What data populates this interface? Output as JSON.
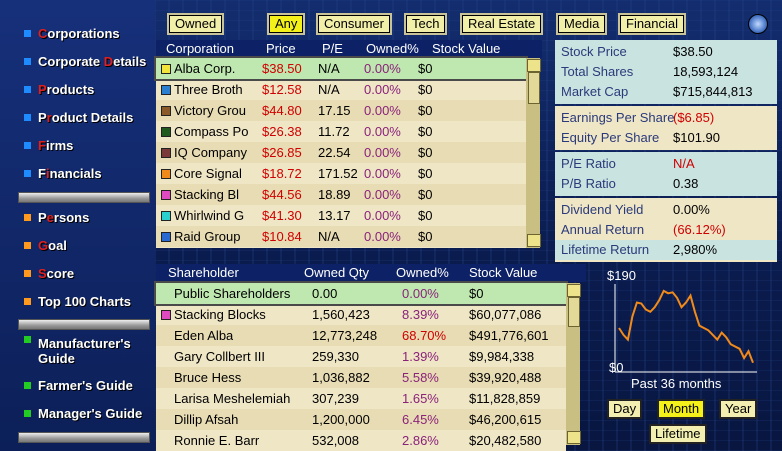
{
  "sidebar": {
    "items": [
      {
        "pre": "",
        "hl": "C",
        "post": "orporations",
        "color": "#1e8cff"
      },
      {
        "pre": "Corporate ",
        "hl": "D",
        "post": "etails",
        "color": "#1e8cff"
      },
      {
        "pre": "",
        "hl": "P",
        "post": "roducts",
        "color": "#1e8cff"
      },
      {
        "pre": "P",
        "hl": "r",
        "post": "oduct Details",
        "color": "#1e8cff"
      },
      {
        "pre": "",
        "hl": "F",
        "post": "irms",
        "color": "#1e8cff"
      },
      {
        "pre": "F",
        "hl": "i",
        "post": "nancials",
        "color": "#1e8cff"
      },
      {
        "pre": "P",
        "hl": "e",
        "post": "rsons",
        "color": "#ff9a1e"
      },
      {
        "pre": "",
        "hl": "G",
        "post": "oal",
        "color": "#ff9a1e"
      },
      {
        "pre": "",
        "hl": "S",
        "post": "core",
        "color": "#ff9a1e"
      },
      {
        "pre": "Top 100 Charts",
        "hl": "",
        "post": "",
        "color": "#ff9a1e"
      },
      {
        "pre": "Manufacturer's",
        "hl": "",
        "post": "",
        "line2": "Guide",
        "color": "#22cc22"
      },
      {
        "pre": "Farmer's Guide",
        "hl": "",
        "post": "",
        "color": "#22cc22"
      },
      {
        "pre": "Manager's Guide",
        "hl": "",
        "post": "",
        "color": "#22cc22"
      }
    ]
  },
  "filters": {
    "owned": "Owned",
    "any": "Any",
    "consumer": "Consumer",
    "tech": "Tech",
    "real_estate": "Real Estate",
    "media": "Media",
    "financial": "Financial"
  },
  "corp_table": {
    "headers": {
      "corporation": "Corporation",
      "price": "Price",
      "pe": "P/E",
      "owned": "Owned%",
      "stock_value": "Stock Value"
    },
    "rows": [
      {
        "name": "Alba Corp.",
        "price": "$38.50",
        "pe": "N/A",
        "owned": "0.00%",
        "value": "$0",
        "color": "#f2e43a"
      },
      {
        "name": "Three Broth",
        "price": "$12.58",
        "pe": "N/A",
        "owned": "0.00%",
        "value": "$0",
        "color": "#2a7fd0"
      },
      {
        "name": "Victory Grou",
        "price": "$44.80",
        "pe": "17.15",
        "owned": "0.00%",
        "value": "$0",
        "color": "#8a5a2a"
      },
      {
        "name": "Compass Po",
        "price": "$26.38",
        "pe": "11.72",
        "owned": "0.00%",
        "value": "$0",
        "color": "#1f5a1f"
      },
      {
        "name": "IQ Company",
        "price": "$26.85",
        "pe": "22.54",
        "owned": "0.00%",
        "value": "$0",
        "color": "#7a3a3a"
      },
      {
        "name": "Core Signal",
        "price": "$18.72",
        "pe": "171.52",
        "owned": "0.00%",
        "value": "$0",
        "color": "#f08a1a"
      },
      {
        "name": "Stacking Bl",
        "price": "$44.56",
        "pe": "18.89",
        "owned": "0.00%",
        "value": "$0",
        "color": "#e04ac0"
      },
      {
        "name": "Whirlwind G",
        "price": "$41.30",
        "pe": "13.17",
        "owned": "0.00%",
        "value": "$0",
        "color": "#2ad0d0"
      },
      {
        "name": "Raid Group",
        "price": "$10.84",
        "pe": "N/A",
        "owned": "0.00%",
        "value": "$0",
        "color": "#2a6ad0"
      }
    ]
  },
  "stats": {
    "stock_price": {
      "label": "Stock Price",
      "value": "$38.50"
    },
    "total_shares": {
      "label": "Total Shares",
      "value": "18,593,124"
    },
    "market_cap": {
      "label": "Market Cap",
      "value": "$715,844,813"
    },
    "eps": {
      "label": "Earnings Per Share",
      "value": "($6.85)"
    },
    "equity": {
      "label": "Equity Per Share",
      "value": "$101.90"
    },
    "pe_ratio": {
      "label": "P/E Ratio",
      "value": "N/A"
    },
    "pb_ratio": {
      "label": "P/B Ratio",
      "value": "0.38"
    },
    "dividend": {
      "label": "Dividend Yield",
      "value": "0.00%"
    },
    "annual_return": {
      "label": "Annual Return",
      "value": "(66.12%)"
    },
    "lifetime_return": {
      "label": "Lifetime Return",
      "value": "2,980%"
    }
  },
  "share_table": {
    "headers": {
      "holder": "Shareholder",
      "qty": "Owned Qty",
      "owned": "Owned%",
      "value": "Stock Value"
    },
    "rows": [
      {
        "name": "Public Shareholders",
        "qty": "0.00",
        "owned": "0.00%",
        "value": "$0",
        "color": ""
      },
      {
        "name": "Stacking Blocks",
        "qty": "1,560,423",
        "owned": "8.39%",
        "value": "$60,077,086",
        "color": "#e04ac0"
      },
      {
        "name": "Eden Alba",
        "qty": "12,773,248",
        "owned": "68.70%",
        "value": "$491,776,601",
        "color": ""
      },
      {
        "name": "Gary Collbert III",
        "qty": "259,330",
        "owned": "1.39%",
        "value": "$9,984,338",
        "color": ""
      },
      {
        "name": "Bruce Hess",
        "qty": "1,036,882",
        "owned": "5.58%",
        "value": "$39,920,488",
        "color": ""
      },
      {
        "name": "Larisa Meshelemiah",
        "qty": "307,239",
        "owned": "1.65%",
        "value": "$11,828,859",
        "color": ""
      },
      {
        "name": "Dillip Afsah",
        "qty": "1,200,000",
        "owned": "6.45%",
        "value": "$46,200,615",
        "color": ""
      },
      {
        "name": "Ronnie E. Barr",
        "qty": "532,008",
        "owned": "2.86%",
        "value": "$20,482,580",
        "color": ""
      }
    ]
  },
  "graph": {
    "ymax": "$190",
    "ymin": "$0",
    "caption": "Past 36 months",
    "values": [
      95,
      80,
      70,
      120,
      150,
      148,
      135,
      130,
      140,
      155,
      175,
      170,
      172,
      160,
      140,
      150,
      165,
      130,
      100,
      95,
      90,
      80,
      70,
      85,
      75,
      60,
      55,
      50,
      30,
      45,
      20
    ],
    "day": "Day",
    "month": "Month",
    "year": "Year",
    "lifetime": "Lifetime"
  },
  "colors": {
    "accent": "#f3f01a",
    "line": "#f08a1a"
  }
}
